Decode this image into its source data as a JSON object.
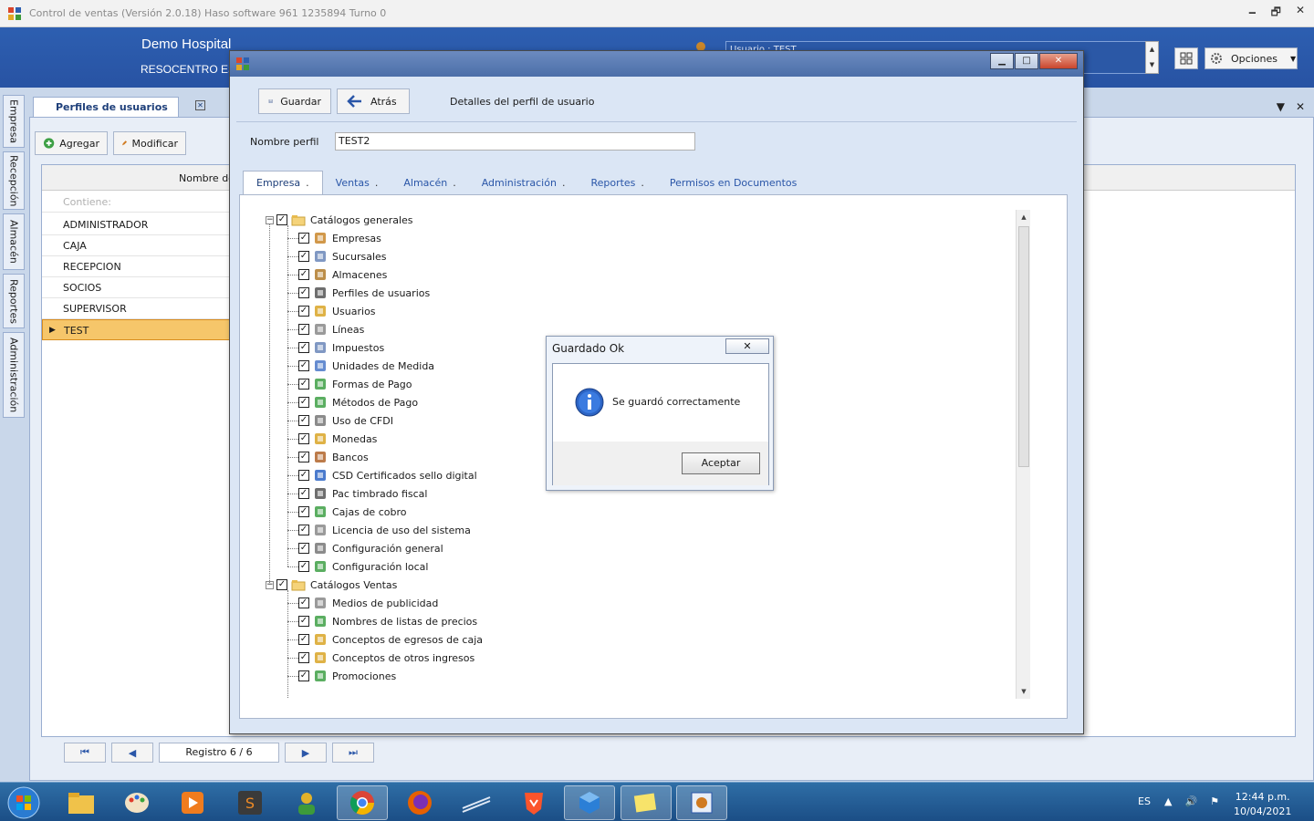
{
  "app": {
    "title": "Control de ventas  (Versión 2.0.18)  Haso software  961 1235894  Turno 0",
    "company": "Demo Hospital",
    "branch": "RESOCENTRO ES",
    "user_line": "Usuario : TEST",
    "options_label": "Opciones",
    "win_minimize": "🗕",
    "win_restore": "🗗",
    "win_close": "✕"
  },
  "side_tabs": [
    "Empresa",
    "Recepción",
    "Almacén",
    "Reportes",
    "Administración"
  ],
  "background": {
    "doc_tab": "Perfiles de usuarios",
    "buttons": {
      "add": "Agregar",
      "edit": "Modificar"
    },
    "column_header": "Nombre de",
    "filter_placeholder": "Contiene:",
    "rows": [
      "ADMINISTRADOR",
      "CAJA",
      "RECEPCION",
      "SOCIOS",
      "SUPERVISOR",
      "TEST"
    ],
    "selected_row": "TEST",
    "pager_label": "Registro  6 / 6"
  },
  "detail": {
    "save_label": "Guardar",
    "back_label": "Atrás",
    "heading": "Detalles del perfil de usuario",
    "name_label": "Nombre perfil",
    "name_value": "TEST2",
    "tabs": [
      "Empresa",
      "Ventas",
      "Almacén",
      "Administración",
      "Reportes",
      "Permisos en Documentos"
    ],
    "active_tab": "Empresa",
    "tree": {
      "group1": "Catálogos generales",
      "group1_items": [
        {
          "label": "Empresas",
          "icon": "building-icon"
        },
        {
          "label": "Sucursales",
          "icon": "branch-icon"
        },
        {
          "label": "Almacenes",
          "icon": "warehouse-icon"
        },
        {
          "label": "Perfiles de usuarios",
          "icon": "user-profile-icon"
        },
        {
          "label": "Usuarios",
          "icon": "users-icon"
        },
        {
          "label": "Líneas",
          "icon": "lines-icon"
        },
        {
          "label": "Impuestos",
          "icon": "tax-icon"
        },
        {
          "label": "Unidades de Medida",
          "icon": "thermometer-icon"
        },
        {
          "label": "Formas de Pago",
          "icon": "payment-icon"
        },
        {
          "label": "Métodos de Pago",
          "icon": "dollar-icon"
        },
        {
          "label": "Uso de CFDI",
          "icon": "document-icon"
        },
        {
          "label": "Monedas",
          "icon": "coins-icon"
        },
        {
          "label": "Bancos",
          "icon": "bank-icon"
        },
        {
          "label": "CSD Certificados sello digital",
          "icon": "certificate-icon"
        },
        {
          "label": "Pac timbrado fiscal",
          "icon": "qr-icon"
        },
        {
          "label": "Cajas de cobro",
          "icon": "register-icon"
        },
        {
          "label": "Licencia de uso del sistema",
          "icon": "license-icon"
        },
        {
          "label": "Configuración general",
          "icon": "gear-icon"
        },
        {
          "label": "Configuración local",
          "icon": "local-gear-icon"
        }
      ],
      "group2": "Catálogos Ventas",
      "group2_items": [
        {
          "label": "Medios de publicidad",
          "icon": "ads-icon"
        },
        {
          "label": "Nombres de listas de precios",
          "icon": "price-tag-icon"
        },
        {
          "label": "Conceptos de egresos de caja",
          "icon": "expense-icon"
        },
        {
          "label": "Conceptos de otros ingresos",
          "icon": "income-icon"
        },
        {
          "label": "Promociones",
          "icon": "promo-icon"
        }
      ]
    }
  },
  "msgbox": {
    "title": "Guardado Ok",
    "close": "✕",
    "message": "Se guardó correctamente",
    "ok_label": "Aceptar"
  },
  "taskbar": {
    "lang": "ES",
    "time": "12:44 p.m.",
    "date": "10/04/2021"
  }
}
